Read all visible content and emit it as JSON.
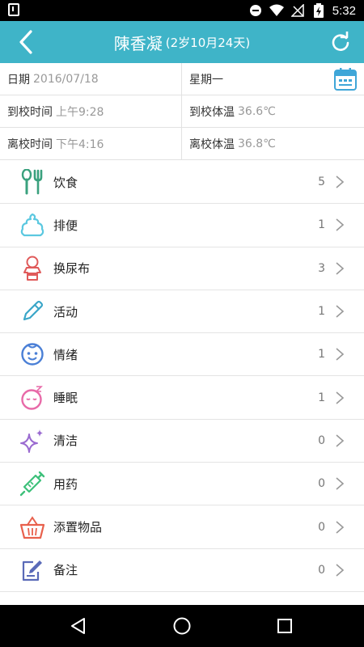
{
  "status_bar": {
    "time": "5:32"
  },
  "header": {
    "name": "陳香凝",
    "age": "(2岁10月24天)"
  },
  "info": {
    "date_label": "日期",
    "date_value": "2016/07/18",
    "weekday": "星期一",
    "arrive_time_label": "到校时间",
    "arrive_time_value": "上午9:28",
    "arrive_temp_label": "到校体温",
    "arrive_temp_value": "36.6℃",
    "leave_time_label": "离校时间",
    "leave_time_value": "下午4:16",
    "leave_temp_label": "离校体温",
    "leave_temp_value": "36.8℃"
  },
  "items": [
    {
      "label": "饮食",
      "count": "5",
      "icon": "utensils-icon",
      "color": "#3aa17e"
    },
    {
      "label": "排便",
      "count": "1",
      "icon": "poop-icon",
      "color": "#5bc8e0"
    },
    {
      "label": "换尿布",
      "count": "3",
      "icon": "baby-diaper-icon",
      "color": "#e05a5a"
    },
    {
      "label": "活动",
      "count": "1",
      "icon": "pencil-icon",
      "color": "#3aa6c8"
    },
    {
      "label": "情绪",
      "count": "1",
      "icon": "baby-face-icon",
      "color": "#4a7fd6"
    },
    {
      "label": "睡眠",
      "count": "1",
      "icon": "sleep-icon",
      "color": "#e86aa8"
    },
    {
      "label": "清洁",
      "count": "0",
      "icon": "sparkle-icon",
      "color": "#9a6ad0"
    },
    {
      "label": "用药",
      "count": "0",
      "icon": "syringe-icon",
      "color": "#3dc07a"
    },
    {
      "label": "添置物品",
      "count": "0",
      "icon": "basket-icon",
      "color": "#e8604c"
    },
    {
      "label": "备注",
      "count": "0",
      "icon": "note-icon",
      "color": "#5a6ab8"
    }
  ],
  "colors": {
    "accent": "#3fb4c8"
  }
}
